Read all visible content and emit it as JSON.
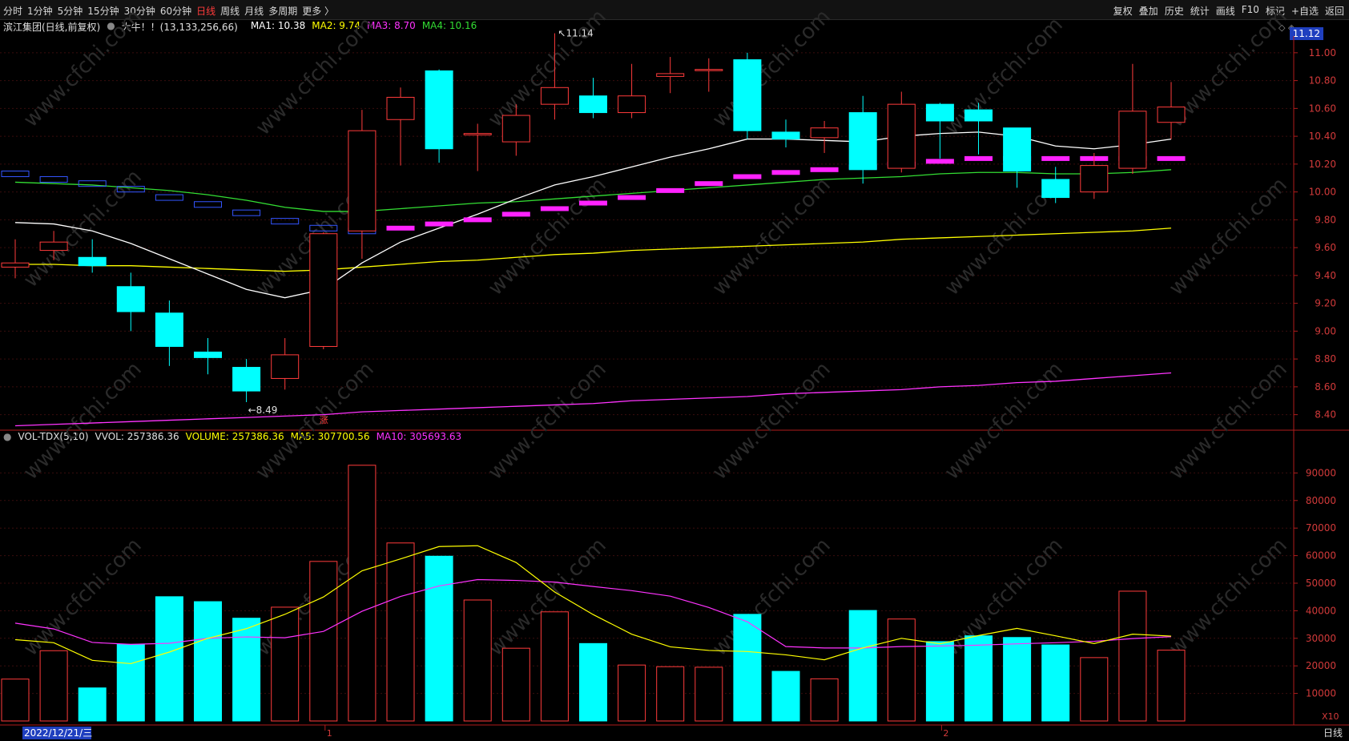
{
  "toolbar": {
    "left_items": [
      "分时",
      "1分钟",
      "5分钟",
      "15分钟",
      "30分钟",
      "60分钟",
      "日线",
      "周线",
      "月线",
      "多周期",
      "更多 〉"
    ],
    "active_item": "日线",
    "right_items": [
      "复权",
      "叠加",
      "历史",
      "统计",
      "画线",
      "F10",
      "标记",
      "+自选",
      "返回"
    ]
  },
  "info": {
    "stock": "滨江集团(日线,前复权)",
    "indicator": "大牛！！(13,133,256,66)",
    "ma1": "MA1: 10.38",
    "ma2": "MA2: 9.74",
    "ma3": "MA3: 8.70",
    "ma4": "MA4: 10.16",
    "current_price_tag": "11.12",
    "ma_colors": {
      "ma1": "#ffffff",
      "ma2": "#ffff00",
      "ma3": "#ff33ff",
      "ma4": "#33dd33"
    }
  },
  "volume_info": {
    "name": "VOL-TDX(5,10)",
    "vvol": "VVOL: 257386.36",
    "volume": "VOLUME: 257386.36",
    "ma5": "MA5: 307700.56",
    "ma10": "MA10: 305693.63"
  },
  "bottom": {
    "date_label": "2022/12/21/三",
    "month_ticks": [
      "1",
      "2"
    ],
    "x10": "X10",
    "tab": "日线",
    "zhang": "涨"
  },
  "chart_data": {
    "type": "candlestick",
    "price_axis": {
      "ticks": [
        8.4,
        8.6,
        8.8,
        9.0,
        9.2,
        9.4,
        9.6,
        9.8,
        10.0,
        10.2,
        10.4,
        10.6,
        10.8,
        11.0
      ],
      "ylim": [
        8.3,
        11.12
      ]
    },
    "annotations": {
      "high_label": "11.14",
      "low_label": "8.49"
    },
    "colors": {
      "up": "#ff3b3b",
      "down": "#00ffff",
      "ma1": "#ffffff",
      "ma2": "#ffff00",
      "ma3": "#ff33ff",
      "ma4": "#33dd33",
      "blue": "#3355ff",
      "magenta_bar": "#ff22ff"
    },
    "candles": [
      {
        "o": 9.46,
        "h": 9.66,
        "l": 9.38,
        "c": 9.49
      },
      {
        "o": 9.58,
        "h": 9.72,
        "l": 9.51,
        "c": 9.64
      },
      {
        "o": 9.53,
        "h": 9.66,
        "l": 9.42,
        "c": 9.47
      },
      {
        "o": 9.32,
        "h": 9.42,
        "l": 9.0,
        "c": 9.14
      },
      {
        "o": 9.13,
        "h": 9.22,
        "l": 8.75,
        "c": 8.89
      },
      {
        "o": 8.85,
        "h": 8.95,
        "l": 8.69,
        "c": 8.81
      },
      {
        "o": 8.74,
        "h": 8.8,
        "l": 8.49,
        "c": 8.57
      },
      {
        "o": 8.66,
        "h": 8.95,
        "l": 8.58,
        "c": 8.83
      },
      {
        "o": 8.89,
        "h": 9.71,
        "l": 8.87,
        "c": 9.7
      },
      {
        "o": 9.72,
        "h": 10.59,
        "l": 9.52,
        "c": 10.44
      },
      {
        "o": 10.52,
        "h": 10.75,
        "l": 10.19,
        "c": 10.68
      },
      {
        "o": 10.87,
        "h": 10.88,
        "l": 10.21,
        "c": 10.31
      },
      {
        "o": 10.41,
        "h": 10.49,
        "l": 10.15,
        "c": 10.42
      },
      {
        "o": 10.36,
        "h": 10.63,
        "l": 10.26,
        "c": 10.55
      },
      {
        "o": 10.63,
        "h": 11.14,
        "l": 10.52,
        "c": 10.75
      },
      {
        "o": 10.69,
        "h": 10.82,
        "l": 10.53,
        "c": 10.57
      },
      {
        "o": 10.57,
        "h": 10.92,
        "l": 10.53,
        "c": 10.69
      },
      {
        "o": 10.83,
        "h": 10.97,
        "l": 10.71,
        "c": 10.85
      },
      {
        "o": 10.88,
        "h": 10.96,
        "l": 10.72,
        "c": 10.88
      },
      {
        "o": 10.95,
        "h": 11.0,
        "l": 10.38,
        "c": 10.44
      },
      {
        "o": 10.43,
        "h": 10.52,
        "l": 10.32,
        "c": 10.38
      },
      {
        "o": 10.39,
        "h": 10.51,
        "l": 10.28,
        "c": 10.46
      },
      {
        "o": 10.57,
        "h": 10.69,
        "l": 10.06,
        "c": 10.16
      },
      {
        "o": 10.17,
        "h": 10.72,
        "l": 10.14,
        "c": 10.63
      },
      {
        "o": 10.63,
        "h": 10.64,
        "l": 10.24,
        "c": 10.51
      },
      {
        "o": 10.59,
        "h": 10.64,
        "l": 10.27,
        "c": 10.51
      },
      {
        "o": 10.46,
        "h": 10.46,
        "l": 10.03,
        "c": 10.15
      },
      {
        "o": 10.09,
        "h": 10.18,
        "l": 9.92,
        "c": 9.96
      },
      {
        "o": 10.0,
        "h": 10.28,
        "l": 9.95,
        "c": 10.19
      },
      {
        "o": 10.17,
        "h": 10.92,
        "l": 10.13,
        "c": 10.58
      },
      {
        "o": 10.5,
        "h": 10.79,
        "l": 10.38,
        "c": 10.61
      }
    ],
    "ma1": [
      9.78,
      9.77,
      9.72,
      9.63,
      9.52,
      9.41,
      9.3,
      9.24,
      9.3,
      9.49,
      9.64,
      9.74,
      9.84,
      9.95,
      10.05,
      10.11,
      10.18,
      10.25,
      10.31,
      10.38,
      10.38,
      10.37,
      10.36,
      10.4,
      10.42,
      10.43,
      10.4,
      10.33,
      10.31,
      10.34,
      10.38
    ],
    "ma2": [
      9.48,
      9.48,
      9.47,
      9.47,
      9.46,
      9.45,
      9.44,
      9.43,
      9.44,
      9.46,
      9.48,
      9.5,
      9.51,
      9.53,
      9.55,
      9.56,
      9.58,
      9.59,
      9.6,
      9.61,
      9.62,
      9.63,
      9.64,
      9.66,
      9.67,
      9.68,
      9.69,
      9.7,
      9.71,
      9.72,
      9.74
    ],
    "ma3": [
      8.32,
      8.33,
      8.34,
      8.35,
      8.36,
      8.37,
      8.38,
      8.39,
      8.4,
      8.42,
      8.43,
      8.44,
      8.45,
      8.46,
      8.47,
      8.48,
      8.5,
      8.51,
      8.52,
      8.53,
      8.55,
      8.56,
      8.57,
      8.58,
      8.6,
      8.61,
      8.63,
      8.64,
      8.66,
      8.68,
      8.7
    ],
    "ma4": [
      10.07,
      10.06,
      10.05,
      10.03,
      10.01,
      9.98,
      9.94,
      9.89,
      9.86,
      9.86,
      9.88,
      9.9,
      9.92,
      9.93,
      9.95,
      9.97,
      9.99,
      10.01,
      10.03,
      10.05,
      10.07,
      10.09,
      10.1,
      10.11,
      10.13,
      10.14,
      10.14,
      10.13,
      10.13,
      10.14,
      10.16
    ],
    "step_line": [
      10.13,
      10.09,
      10.06,
      10.02,
      9.96,
      9.91,
      9.85,
      9.79,
      9.74,
      9.72,
      9.74,
      9.77,
      9.8,
      9.84,
      9.88,
      9.92,
      9.96,
      10.01,
      10.06,
      10.11,
      10.14,
      10.16,
      10.18,
      10.2,
      10.22,
      10.24,
      10.24,
      10.24,
      10.24,
      10.24,
      10.24
    ],
    "volume_axis": {
      "ticks": [
        10000,
        20000,
        30000,
        40000,
        50000,
        60000,
        70000,
        80000,
        90000
      ],
      "ylim": [
        0,
        100000
      ]
    },
    "volume": [
      15200,
      25500,
      12000,
      27800,
      45100,
      43300,
      37300,
      41300,
      57900,
      92800,
      64600,
      59800,
      43900,
      26400,
      39600,
      28100,
      20300,
      19700,
      19500,
      38700,
      18000,
      15300,
      40100,
      37000,
      28800,
      30900,
      30300,
      27600,
      23000,
      47100,
      25700
    ],
    "vol_ma5": [
      29500,
      28400,
      22000,
      20800,
      25000,
      30000,
      33500,
      38700,
      45000,
      54500,
      58800,
      63300,
      63600,
      57500,
      46800,
      38600,
      31500,
      26900,
      25600,
      25200,
      24000,
      22200,
      26500,
      30000,
      28000,
      31000,
      33600,
      30900,
      28100,
      31500,
      30800
    ],
    "vol_ma10": [
      35500,
      33400,
      28500,
      27800,
      28200,
      30000,
      30500,
      30200,
      32500,
      39800,
      45200,
      49000,
      51300,
      51000,
      50400,
      48800,
      47300,
      45300,
      41200,
      36000,
      27000,
      26500,
      26500,
      27000,
      27200,
      27500,
      28000,
      28400,
      28900,
      29900,
      30600
    ]
  }
}
